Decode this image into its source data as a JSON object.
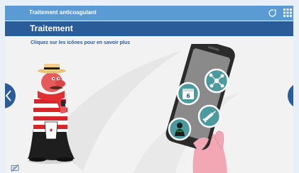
{
  "header": {
    "app_title": "Traitement anticoagulant",
    "refresh_icon": "refresh-icon",
    "grid_icon": "grid-menu-icon"
  },
  "section": {
    "title": "Traitement",
    "instruction": "Cliquez sur les icônes pour en savoir plus"
  },
  "navigation": {
    "prev_icon": "chevron-left-icon",
    "next_icon": "chevron-right-icon"
  },
  "phone_icons": [
    {
      "name": "network-icon"
    },
    {
      "name": "calendar-icon"
    },
    {
      "name": "syringe-icon"
    },
    {
      "name": "person-icon"
    }
  ],
  "footer": {
    "caption_icon": "subtitles-off-icon"
  },
  "colors": {
    "topbar": "#5b9bd5",
    "section_bar": "#2a5c9a",
    "accent": "#2a5c9a",
    "hotspot_ring": "#ffffff",
    "hotspot_fill": "#4a9aa0"
  }
}
